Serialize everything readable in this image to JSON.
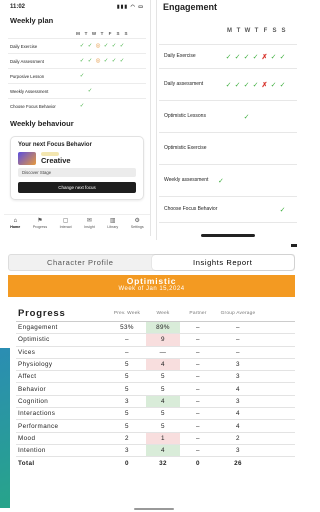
{
  "left": {
    "status_time": "11:02",
    "status_icons": "▮▮▮ ◠ ▭",
    "weekly_plan_title": "Weekly plan",
    "days": [
      "M",
      "T",
      "W",
      "T",
      "F",
      "S",
      "S"
    ],
    "plan_rows": [
      {
        "label": "Daily Exercise",
        "marks": [
          "",
          "✓",
          "✓",
          "◎",
          "✓",
          "✓",
          "✓"
        ]
      },
      {
        "label": "Daily Assessment",
        "marks": [
          "",
          "✓",
          "✓",
          "◎",
          "✓",
          "✓",
          "✓"
        ]
      },
      {
        "label": "Purposive Lesson",
        "marks": [
          "",
          "✓",
          "",
          "",
          "",
          "",
          ""
        ]
      },
      {
        "label": "Weekly Assessment",
        "marks": [
          "",
          "",
          "✓",
          "",
          "",
          "",
          ""
        ]
      },
      {
        "label": "Choose Focus Behavior",
        "marks": [
          "",
          "✓",
          "",
          "",
          "",
          "",
          ""
        ]
      }
    ],
    "weekly_behaviour_title": "Weekly behaviour",
    "focus": {
      "title": "Your next Focus Behavior",
      "name": "Creative",
      "stage": "Discover Stage",
      "button": "Change next focus"
    },
    "tabs": [
      {
        "icon": "⌂",
        "label": "Home"
      },
      {
        "icon": "⚑",
        "label": "Progress"
      },
      {
        "icon": "▢",
        "label": "Interact"
      },
      {
        "icon": "✉",
        "label": "Insight"
      },
      {
        "icon": "▥",
        "label": "Library"
      },
      {
        "icon": "⚙",
        "label": "Settings"
      }
    ]
  },
  "engagement": {
    "title": "Engagement",
    "days": [
      "M",
      "T",
      "W",
      "T",
      "F",
      "S",
      "S"
    ],
    "rows": [
      {
        "label": "Daily Exercise",
        "marks": [
          "✓",
          "✓",
          "✓",
          "✓",
          "✗",
          "✓",
          "✓"
        ]
      },
      {
        "label": "Daily assessment",
        "marks": [
          "✓",
          "✓",
          "✓",
          "✓",
          "✗",
          "✓",
          "✓"
        ]
      },
      {
        "label": "Optimistic Lessons",
        "marks": [
          "",
          "",
          "✓",
          "",
          "",
          "",
          ""
        ]
      },
      {
        "label": "Optimistic Exercise",
        "marks": [
          "",
          "",
          "",
          "",
          "",
          "",
          ""
        ]
      },
      {
        "label": "Weekly assessment",
        "marks": [
          "",
          "",
          "",
          "",
          "",
          "",
          ""
        ],
        "inline": "✓"
      },
      {
        "label": "Choose Focus Behavior",
        "marks": [
          "",
          "",
          "",
          "",
          "",
          "",
          "✓"
        ]
      }
    ]
  },
  "insights": {
    "tabs": [
      "Character Profile",
      "Insights Report"
    ],
    "active_tab": 1,
    "banner_title": "Optimistic",
    "banner_subtitle": "Week of Jan 15,2024",
    "accent": "#f39a22",
    "headers": {
      "progress": "Progress",
      "prev": "Prev. Week",
      "week": "Week",
      "partner": "Partner",
      "group": "Group Average"
    },
    "rows": [
      {
        "name": "Engagement",
        "prev": "53%",
        "week": "89%",
        "partner": "–",
        "group": "–",
        "style": "hl"
      },
      {
        "name": "Optimistic",
        "prev": "–",
        "week": "9",
        "partner": "–",
        "group": "–",
        "style": "pk"
      },
      {
        "name": "Vices",
        "prev": "–",
        "week": "—",
        "partner": "–",
        "group": "–",
        "style": ""
      },
      {
        "name": "Physiology",
        "prev": "5",
        "week": "4",
        "partner": "–",
        "group": "3",
        "style": "pk"
      },
      {
        "name": "Affect",
        "prev": "5",
        "week": "5",
        "partner": "–",
        "group": "3",
        "style": ""
      },
      {
        "name": "Behavior",
        "prev": "5",
        "week": "5",
        "partner": "–",
        "group": "4",
        "style": ""
      },
      {
        "name": "Cognition",
        "prev": "3",
        "week": "4",
        "partner": "–",
        "group": "3",
        "style": "hl"
      },
      {
        "name": "Interactions",
        "prev": "5",
        "week": "5",
        "partner": "–",
        "group": "4",
        "style": ""
      },
      {
        "name": "Performance",
        "prev": "5",
        "week": "5",
        "partner": "–",
        "group": "4",
        "style": ""
      },
      {
        "name": "Mood",
        "prev": "2",
        "week": "1",
        "partner": "–",
        "group": "2",
        "style": "pk"
      },
      {
        "name": "Intention",
        "prev": "3",
        "week": "4",
        "partner": "–",
        "group": "3",
        "style": "hl"
      },
      {
        "name": "Total",
        "prev": "0",
        "week": "32",
        "partner": "0",
        "group": "26",
        "style": "total"
      }
    ]
  }
}
